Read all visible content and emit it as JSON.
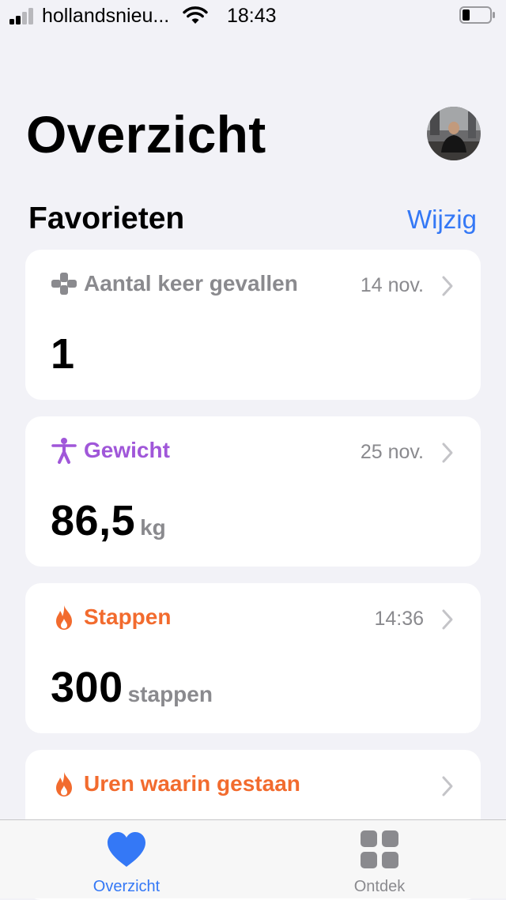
{
  "status_bar": {
    "carrier": "hollandsnieu...",
    "time": "18:43"
  },
  "header": {
    "title": "Overzicht"
  },
  "favorites": {
    "title": "Favorieten",
    "edit_label": "Wijzig"
  },
  "cards": [
    {
      "title": "Aantal keer gevallen",
      "date": "14 nov.",
      "value": "1",
      "unit": "",
      "color": "#8a8a8e",
      "icon": "plus-cross-icon"
    },
    {
      "title": "Gewicht",
      "date": "25 nov.",
      "value": "86,5",
      "unit": "kg",
      "color": "#a057d9",
      "icon": "figure-icon"
    },
    {
      "title": "Stappen",
      "date": "14:36",
      "value": "300",
      "unit": "stappen",
      "color": "#f26b2e",
      "icon": "flame-icon"
    },
    {
      "title": "Uren waarin gestaan",
      "date": "",
      "value": "",
      "unit": "",
      "color": "#f26b2e",
      "icon": "flame-icon"
    }
  ],
  "tab_bar": {
    "tabs": [
      {
        "label": "Overzicht",
        "icon": "heart-icon",
        "active": true,
        "color": "#3478f6"
      },
      {
        "label": "Ontdek",
        "icon": "grid-icon",
        "active": false,
        "color": "#8a8a8e"
      }
    ]
  }
}
